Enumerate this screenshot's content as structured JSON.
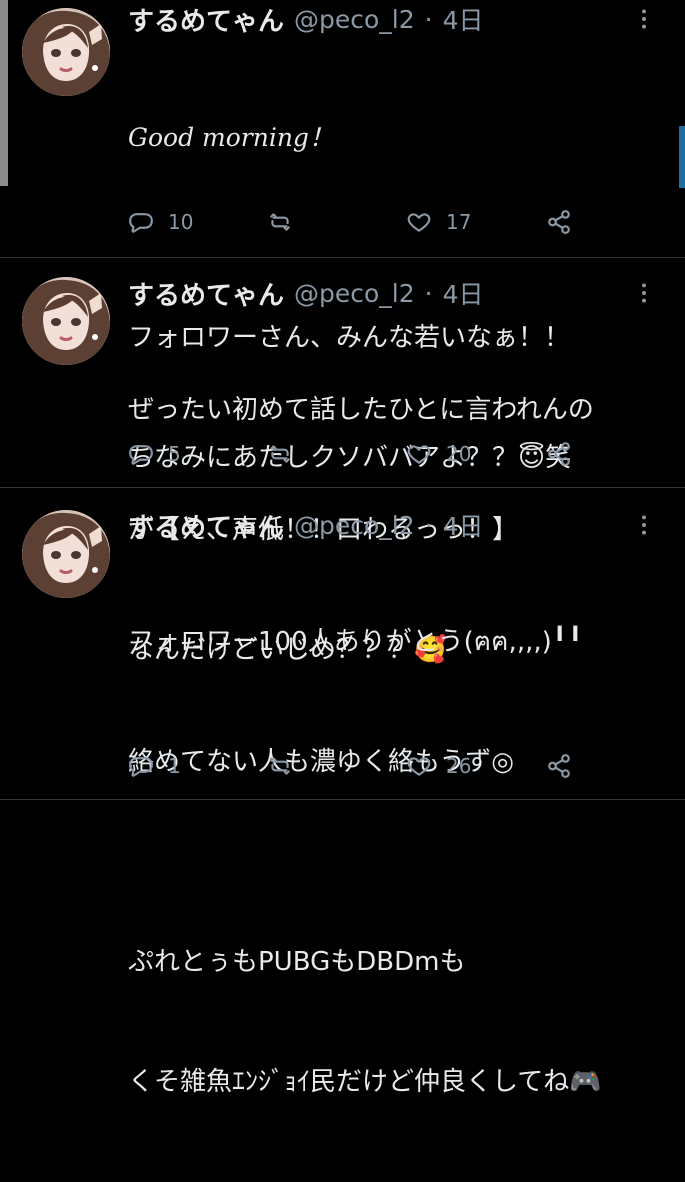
{
  "tweets": [
    {
      "name": "するめてゃん",
      "handle": "@peco_l2",
      "separator": "·",
      "time": "4日",
      "body_lines": [
        "Good morning！",
        "",
        "フォロワーさん、みんな若いなぁ！！",
        "ちなみにあたしクソババアよ？？😇笑"
      ],
      "actions": {
        "reply": "10",
        "retweet": "",
        "like": "17"
      }
    },
    {
      "name": "するめてゃん",
      "handle": "@peco_l2",
      "separator": "·",
      "time": "4日",
      "body_lines": [
        "ぜったい初めて話したひとに言われんの",
        "が【え、声低！！口わるっっ！】",
        "なんだけどいじめ？？？🥰"
      ],
      "actions": {
        "reply": "5",
        "retweet": "",
        "like": "20"
      }
    },
    {
      "name": "するめてゃん",
      "handle": "@peco_l2",
      "separator": "·",
      "time": "4日",
      "body_lines": [
        "フォロワー100人ありがとう(ฅฅ,,,,)╹╹",
        "絡めてない人も濃ゆく絡もうず◎",
        "",
        "ぷれとぅもPUBGもDBDmも",
        "くそ雑魚ｴﾝｼﾞｮｲ民だけど仲良くしてね🎮"
      ],
      "actions": {
        "reply": "1",
        "retweet": "",
        "like": "26"
      }
    }
  ],
  "icons": {
    "more": "more-horizontal-icon",
    "reply": "reply-icon",
    "retweet": "retweet-icon",
    "like": "heart-icon",
    "share": "share-icon"
  },
  "colors": {
    "background": "#000000",
    "text": "#e7e9ea",
    "muted": "#8b98a5",
    "divider": "#2f3336"
  }
}
